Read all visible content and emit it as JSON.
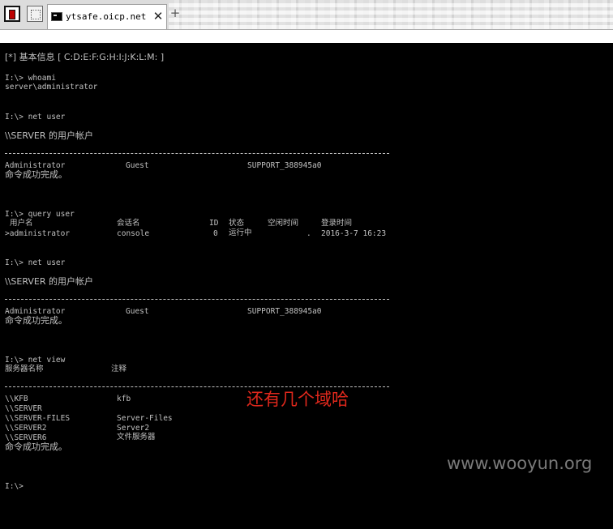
{
  "tab": {
    "title": "ytsafe.oicp.net",
    "close_glyph": "✕",
    "new_tab_glyph": "+"
  },
  "toolbar": {
    "left_buttons": [
      "app-icon",
      "window-icon"
    ]
  },
  "console": {
    "info_line": "[*] 基本信息 [ C:D:E:F:G:H:I:J:K:L:M: ]",
    "cmd_whoami": "I:\\> whoami",
    "whoami_out": "server\\administrator",
    "cmd_netuser1": "I:\\> net user",
    "accounts_header1": "\\\\SERVER 的用户帐户",
    "users1": [
      "Administrator",
      "Guest",
      "SUPPORT_388945a0"
    ],
    "done1": "命令成功完成。",
    "cmd_query": "I:\\> query user",
    "query_headers": [
      "用户名",
      "会话名",
      "ID",
      "状态",
      "空闲时间",
      "登录时间"
    ],
    "query_row": [
      ">administrator",
      "console",
      "0",
      "运行中",
      ".",
      "2016-3-7 16:23"
    ],
    "cmd_netuser2": "I:\\> net user",
    "accounts_header2": "\\\\SERVER 的用户帐户",
    "users2": [
      "Administrator",
      "Guest",
      "SUPPORT_388945a0"
    ],
    "done2": "命令成功完成。",
    "cmd_netview": "I:\\> net view",
    "view_headers": [
      "服务器名称",
      "注释"
    ],
    "servers": [
      {
        "name": "\\\\KFB",
        "note": "kfb"
      },
      {
        "name": "\\\\SERVER",
        "note": ""
      },
      {
        "name": "\\\\SERVER-FILES",
        "note": "Server-Files"
      },
      {
        "name": "\\\\SERVER2",
        "note": "Server2"
      },
      {
        "name": "\\\\SERVER6",
        "note": "文件服务器"
      }
    ],
    "done3": "命令成功完成。",
    "prompt": "I:\\>"
  },
  "annotation": "还有几个域哈",
  "watermark": "www.wooyun.org",
  "colors": {
    "annotation": "#e0281c",
    "console_text": "#c0c0c0",
    "background": "#000000"
  }
}
